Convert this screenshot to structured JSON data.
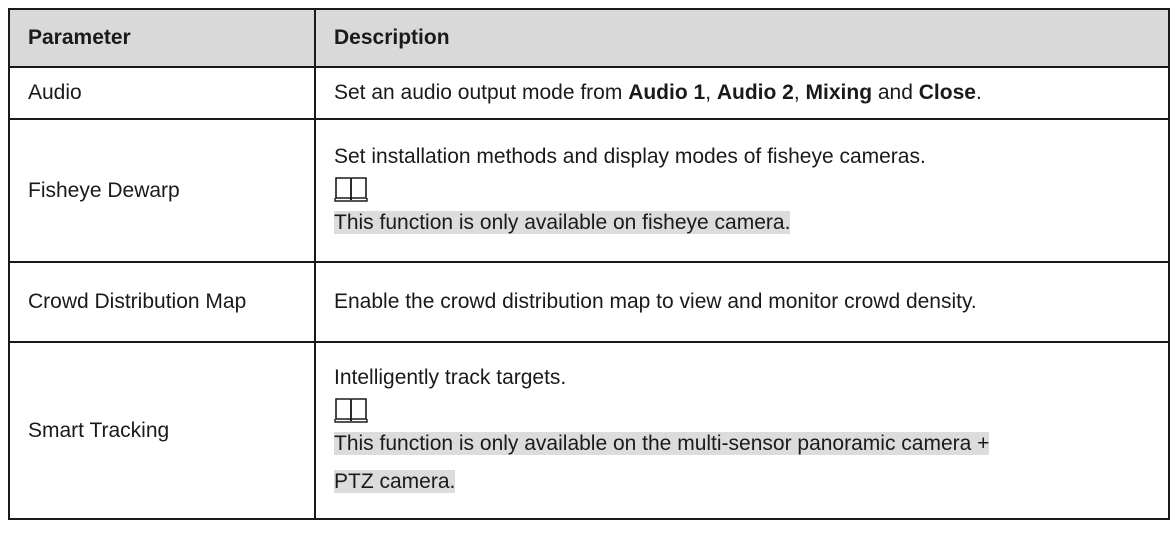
{
  "table": {
    "headers": {
      "parameter": "Parameter",
      "description": "Description"
    },
    "rows": [
      {
        "parameter": "Audio",
        "description_parts": {
          "p0": "Set an audio output mode from ",
          "b1": "Audio 1",
          "p1": ", ",
          "b2": "Audio 2",
          "p2": ", ",
          "b3": "Mixing",
          "p3": " and ",
          "b4": "Close",
          "p4": "."
        }
      },
      {
        "parameter": "Fisheye Dewarp",
        "description": "Set installation methods and display modes of fisheye cameras.",
        "note_icon": "book-icon",
        "note": "This function is only available on fisheye camera."
      },
      {
        "parameter": "Crowd Distribution Map",
        "description": "Enable the crowd distribution map to view and monitor crowd density."
      },
      {
        "parameter": "Smart Tracking",
        "description": "Intelligently track targets.",
        "note_icon": "book-icon",
        "note_line1": "This function is only available on the multi-sensor panoramic camera +",
        "note_line2": "PTZ camera."
      }
    ]
  }
}
